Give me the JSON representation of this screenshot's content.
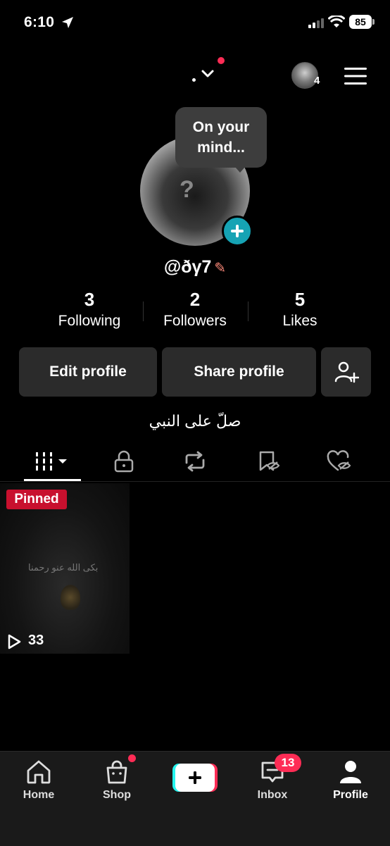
{
  "status_bar": {
    "time": "6:10",
    "battery": "85"
  },
  "header": {
    "mini_avatar_count": "4"
  },
  "profile": {
    "tooltip": "On your mind...",
    "username": "@ðγ7",
    "stats": [
      {
        "value": "3",
        "label": "Following"
      },
      {
        "value": "2",
        "label": "Followers"
      },
      {
        "value": "5",
        "label": "Likes"
      }
    ],
    "buttons": {
      "edit": "Edit profile",
      "share": "Share profile"
    },
    "bio": "صلّ على النبي"
  },
  "videos": [
    {
      "badge": "Pinned",
      "views": "33",
      "caption": "بكى الله عنو رحمنا"
    }
  ],
  "bottom_nav": {
    "items": [
      {
        "label": "Home",
        "icon": "home-icon"
      },
      {
        "label": "Shop",
        "icon": "shop-icon"
      },
      {
        "label": "",
        "icon": "create-icon"
      },
      {
        "label": "Inbox",
        "icon": "inbox-icon"
      },
      {
        "label": "Profile",
        "icon": "profile-icon"
      }
    ],
    "inbox_badge": "13"
  },
  "colors": {
    "accent_red": "#fe2c55",
    "teal": "#16a3b4",
    "pinned_red": "#c8102e"
  }
}
